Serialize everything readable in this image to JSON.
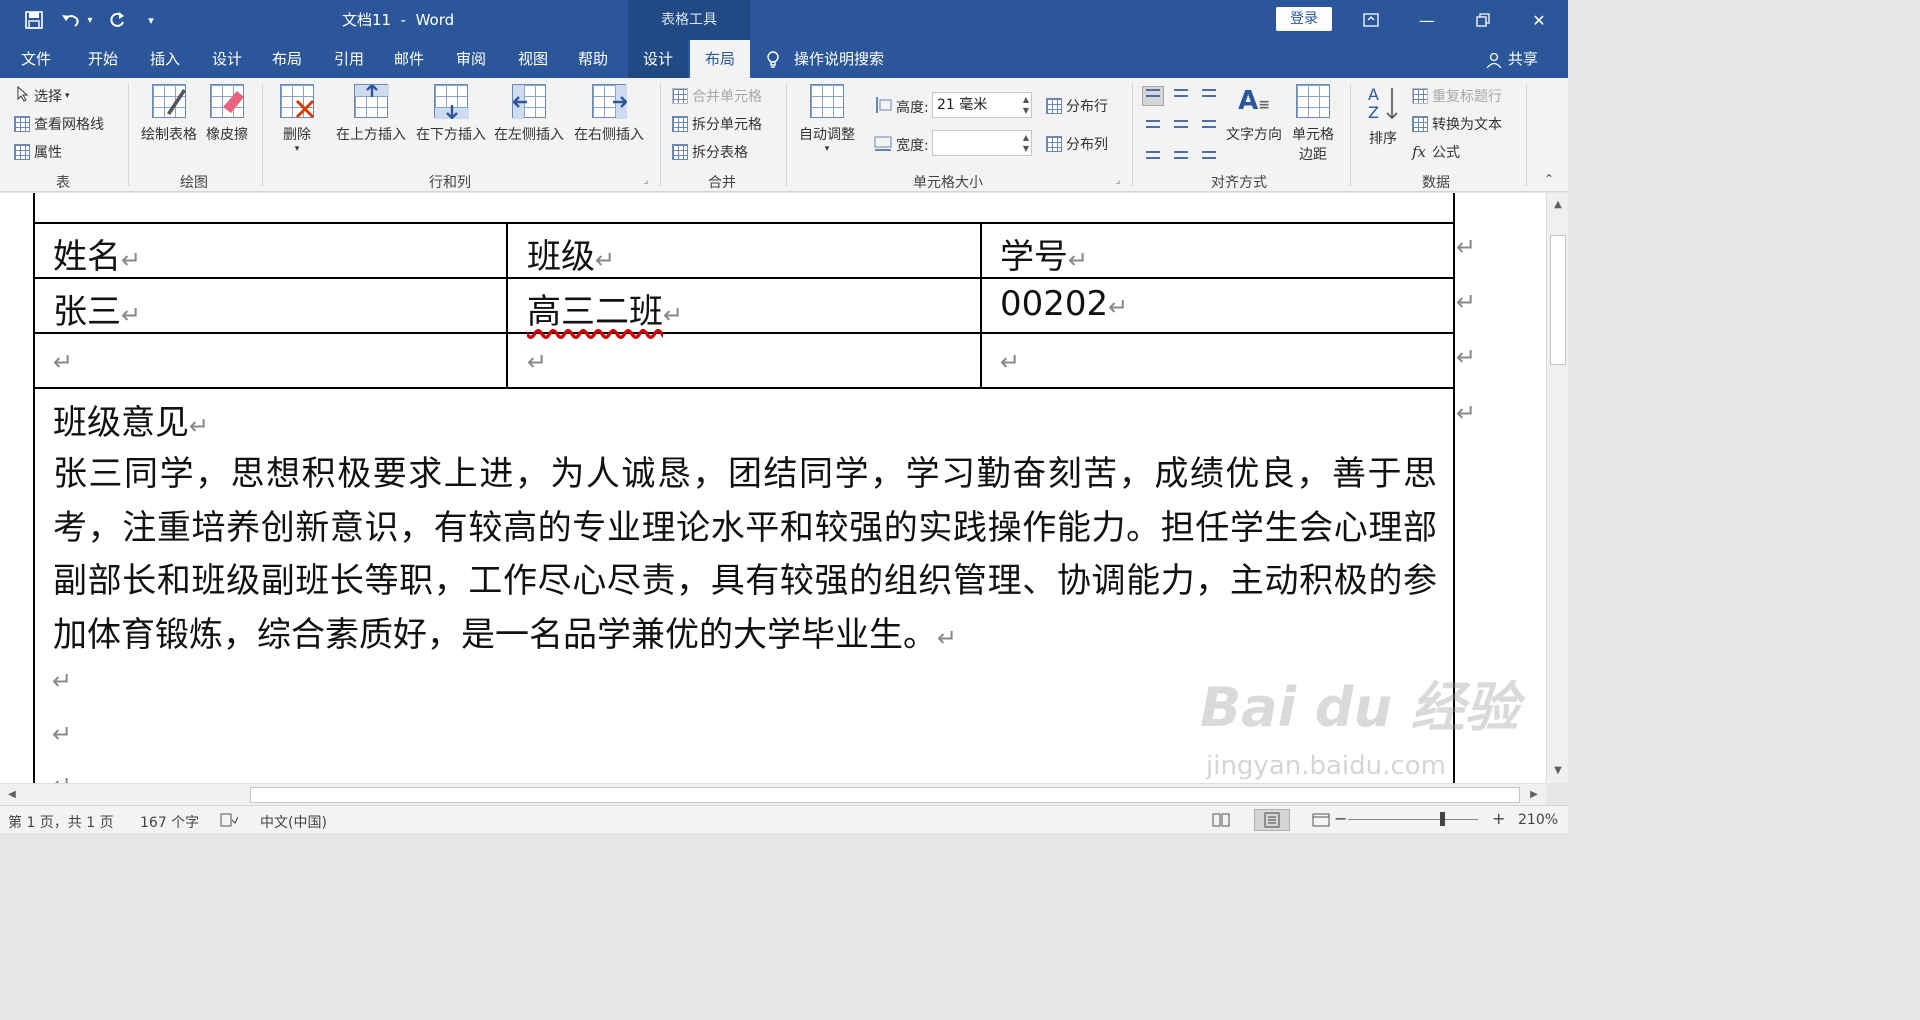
{
  "titlebar": {
    "document_title": "文档11  -  Word",
    "context_header": "表格工具",
    "login_label": "登录",
    "save_icon": "save-icon",
    "undo_icon": "undo-icon",
    "redo_icon": "redo-icon"
  },
  "tabs": [
    {
      "label": "文件"
    },
    {
      "label": "开始"
    },
    {
      "label": "插入"
    },
    {
      "label": "设计"
    },
    {
      "label": "布局"
    },
    {
      "label": "引用"
    },
    {
      "label": "邮件"
    },
    {
      "label": "审阅"
    },
    {
      "label": "视图"
    },
    {
      "label": "帮助"
    },
    {
      "label": "设计"
    },
    {
      "label": "布局"
    }
  ],
  "tell_me": "操作说明搜索",
  "share": "共享",
  "ribbon": {
    "table": {
      "select": "选择",
      "gridlines": "查看网格线",
      "properties": "属性",
      "label": "表"
    },
    "draw": {
      "draw_table": "绘制表格",
      "eraser": "橡皮擦",
      "label": "绘图"
    },
    "rows_cols": {
      "delete": "删除",
      "insert_above": "在上方插入",
      "insert_below": "在下方插入",
      "insert_left": "在左侧插入",
      "insert_right": "在右侧插入",
      "label": "行和列"
    },
    "merge": {
      "merge_cells": "合并单元格",
      "split_cells": "拆分单元格",
      "split_table": "拆分表格",
      "label": "合并"
    },
    "cell_size": {
      "autofit": "自动调整",
      "height_label": "高度:",
      "height_value": "21 毫米",
      "width_label": "宽度:",
      "width_value": "",
      "distribute_rows": "分布行",
      "distribute_cols": "分布列",
      "label": "单元格大小"
    },
    "alignment": {
      "text_direction": "文字方向",
      "cell_margins_1": "单元格",
      "cell_margins_2": "边距",
      "label": "对齐方式"
    },
    "data": {
      "sort": "排序",
      "repeat_header": "重复标题行",
      "convert_to_text": "转换为文本",
      "formula": "公式",
      "label": "数据"
    }
  },
  "table": {
    "header": [
      "姓名",
      "班级",
      "学号"
    ],
    "row1": [
      "张三",
      "高三二班",
      "00202"
    ],
    "row2": [
      "",
      "",
      ""
    ]
  },
  "remark": {
    "title": "班级意见",
    "body": "张三同学，思想积极要求上进，为人诚恳，团结同学，学习勤奋刻苦，成绩优良，善于思考，注重培养创新意识，有较高的专业理论水平和较强的实践操作能力。担任学生会心理部副部长和班级副班长等职，工作尽心尽责，具有较强的组织管理、协调能力，主动积极的参加体育锻炼，综合素质好，是一名品学兼优的大学毕业生。"
  },
  "paragraph_mark": "↵",
  "status": {
    "page": "第 1 页，共 1 页",
    "words": "167 个字",
    "language": "中文(中国)",
    "zoom_percent": "210%",
    "zoom_minus": "−",
    "zoom_plus": "+"
  },
  "watermark": {
    "main": "Bai du 经验",
    "sub": "jingyan.baidu.com"
  },
  "colors": {
    "accent": "#2b579a",
    "context_tab": "#214a84",
    "ribbon_bg": "#f3f3f3"
  }
}
